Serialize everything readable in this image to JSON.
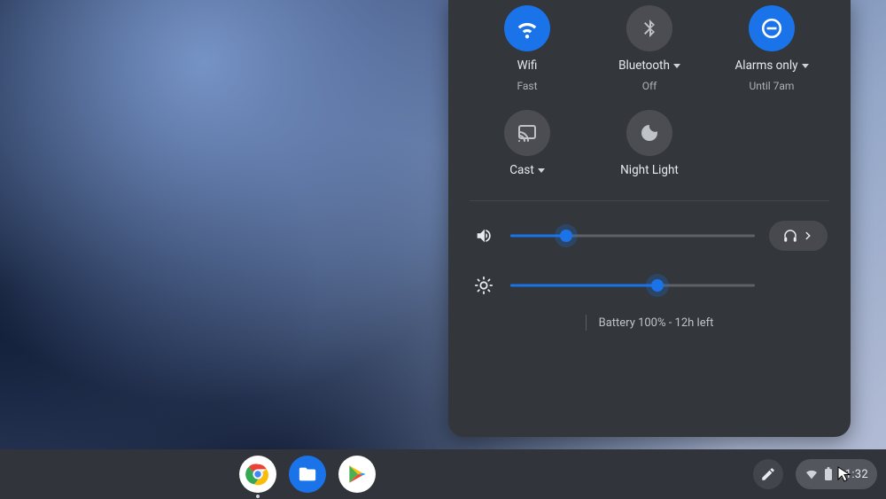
{
  "panel": {
    "toggles": {
      "wifi": {
        "label": "Wifi",
        "sub": "Fast",
        "active": true,
        "hasMenu": false
      },
      "bluetooth": {
        "label": "Bluetooth",
        "sub": "Off",
        "active": false,
        "hasMenu": true
      },
      "dnd": {
        "label": "Alarms only",
        "sub": "Until 7am",
        "active": true,
        "hasMenu": true
      },
      "cast": {
        "label": "Cast",
        "sub": "",
        "active": false,
        "hasMenu": true
      },
      "nightlight": {
        "label": "Night Light",
        "sub": "",
        "active": false,
        "hasMenu": false
      }
    },
    "volume_percent": 23,
    "brightness_percent": 60,
    "footer": "Battery 100% - 12h left"
  },
  "shelf": {
    "apps": {
      "chrome": "Google Chrome",
      "files": "Files",
      "play": "Play Store"
    },
    "time": "11:32"
  },
  "colors": {
    "accent": "#1a73e8"
  }
}
